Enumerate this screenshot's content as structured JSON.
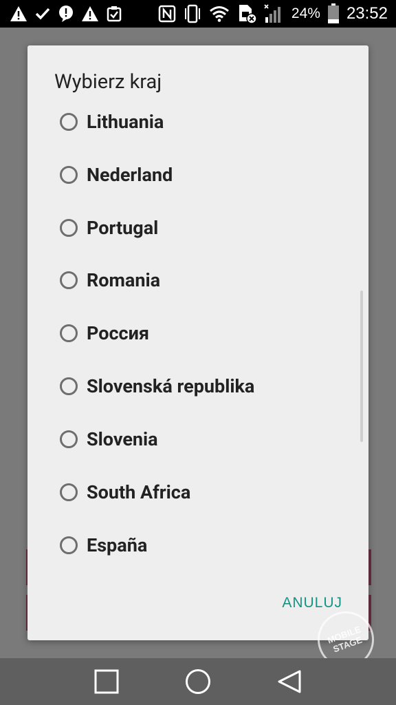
{
  "status_bar": {
    "left_icons": [
      "warning-icon",
      "check-icon",
      "alert-bubble-icon",
      "warning-icon",
      "clipboard-check-icon"
    ],
    "right_icons": [
      "nfc-icon",
      "vibrate-icon",
      "wifi-icon",
      "sim-error-icon",
      "signal-icon"
    ],
    "battery_percent": "24%",
    "battery_level": 0.24,
    "time": "23:52"
  },
  "dialog": {
    "title": "Wybierz kraj",
    "options": [
      {
        "label": "Lithuania",
        "selected": false
      },
      {
        "label": "Nederland",
        "selected": false
      },
      {
        "label": "Portugal",
        "selected": false
      },
      {
        "label": "Romania",
        "selected": false
      },
      {
        "label": "Россия",
        "selected": false
      },
      {
        "label": "Slovenská republika",
        "selected": false
      },
      {
        "label": "Slovenia",
        "selected": false
      },
      {
        "label": "South Africa",
        "selected": false
      },
      {
        "label": "España",
        "selected": false
      }
    ],
    "cancel_label": "ANULUJ"
  },
  "watermark": {
    "line1": "MOBILE",
    "line2": "STAGE"
  },
  "navigation": [
    "recents-icon",
    "home-icon",
    "back-icon"
  ],
  "colors": {
    "accent": "#159483",
    "dialog_bg": "#eeeeee",
    "scrim": "#7a7a7a",
    "status_bar": "#000000",
    "nav_bar": "#5f5f5f"
  }
}
